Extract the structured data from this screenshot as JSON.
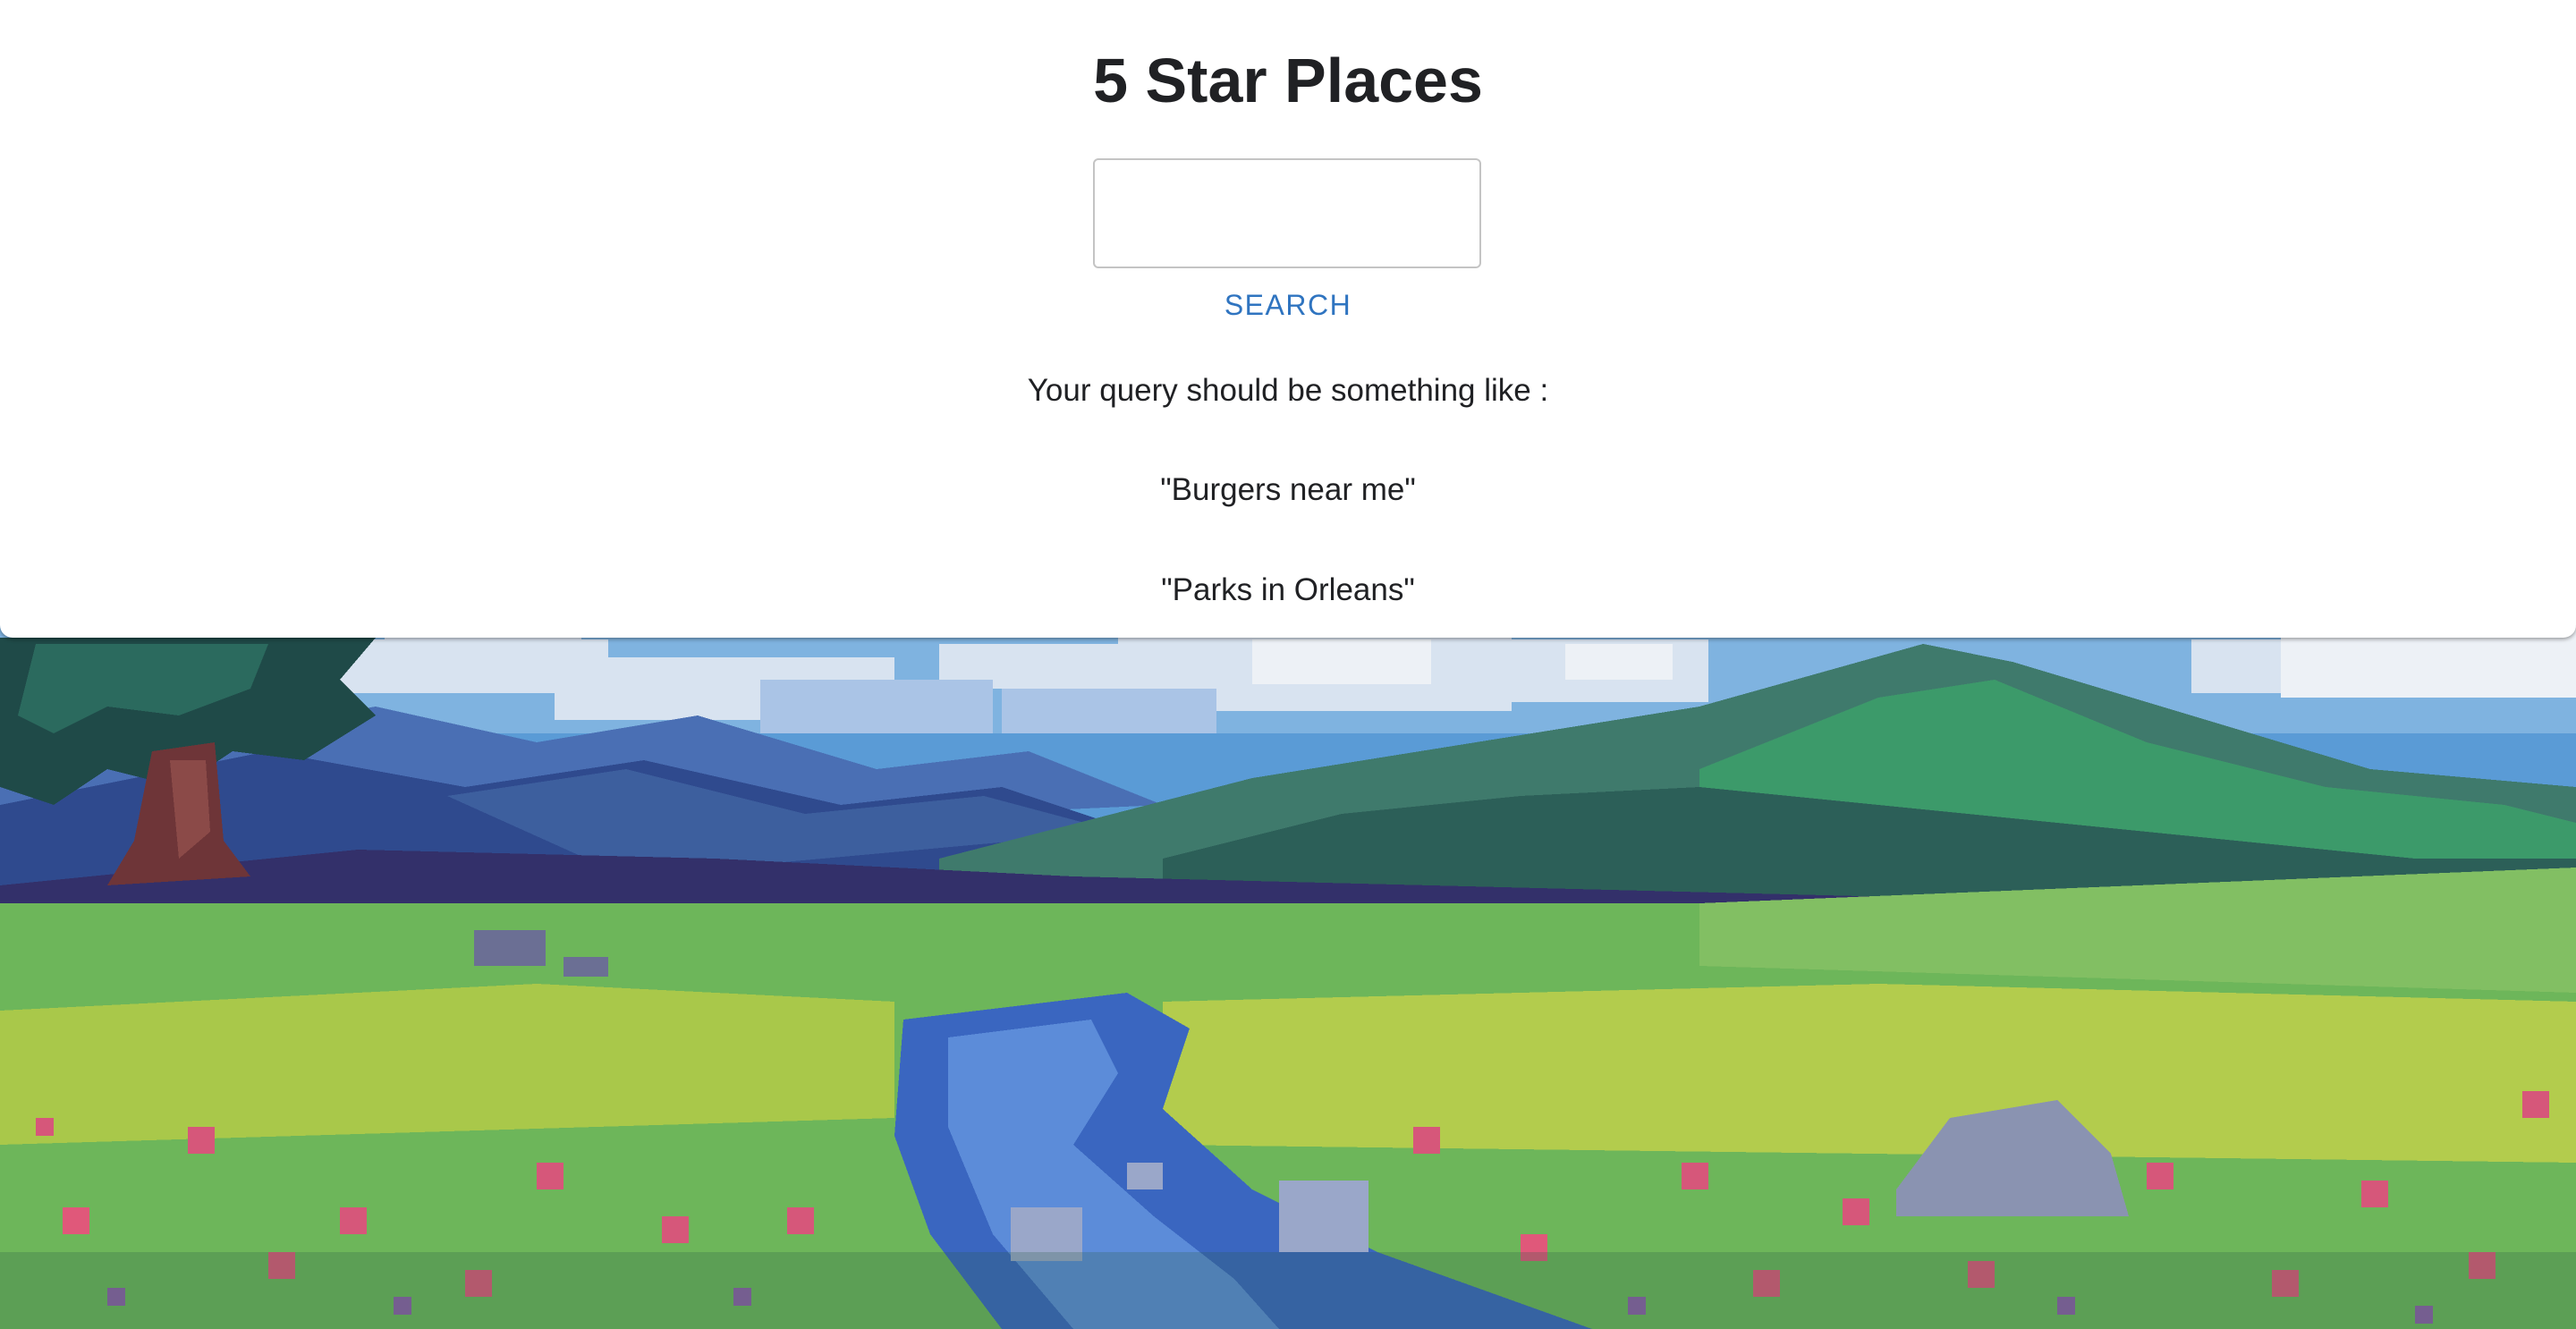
{
  "page": {
    "title": "5 Star Places"
  },
  "search": {
    "value": "",
    "placeholder": "",
    "button_label": "SEARCH"
  },
  "hints": {
    "intro": "Your query should be something like :",
    "examples": [
      "\"Burgers near me\"",
      "\"Parks in Orleans\""
    ]
  },
  "colors": {
    "card_background": "#ffffff",
    "search_button": "#2f74c0",
    "text": "#202124",
    "input_border": "#c4c4c4"
  },
  "background": {
    "icon": "pixel-art-landscape"
  }
}
